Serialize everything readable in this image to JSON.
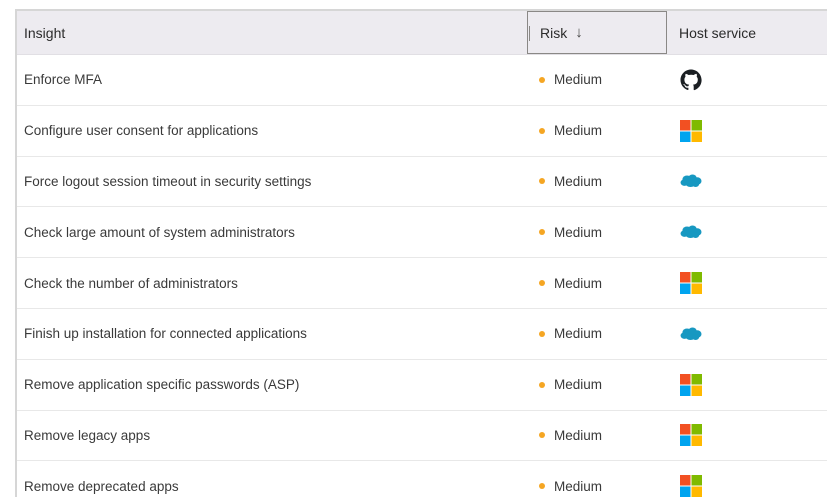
{
  "header": {
    "insight": "Insight",
    "risk": "Risk",
    "risk_sort_icon": "arrow-down-icon",
    "host_service": "Host service"
  },
  "colors": {
    "header_bg": "#edebf0",
    "risk_dot": "#f5a623",
    "salesforce": "#1798c1",
    "github": "#1b1f23",
    "microsoft_red": "#f25022",
    "microsoft_green": "#7fba00",
    "microsoft_blue": "#00a4ef",
    "microsoft_yellow": "#ffb900"
  },
  "rows": [
    {
      "insight": "Enforce MFA",
      "risk": "Medium",
      "service_icon": "github-icon"
    },
    {
      "insight": "Configure user consent for applications",
      "risk": "Medium",
      "service_icon": "microsoft-icon"
    },
    {
      "insight": "Force logout session timeout in security settings",
      "risk": "Medium",
      "service_icon": "salesforce-icon"
    },
    {
      "insight": "Check large amount of system administrators",
      "risk": "Medium",
      "service_icon": "salesforce-icon"
    },
    {
      "insight": "Check the number of administrators",
      "risk": "Medium",
      "service_icon": "microsoft-icon"
    },
    {
      "insight": "Finish up installation for connected applications",
      "risk": "Medium",
      "service_icon": "salesforce-icon"
    },
    {
      "insight": "Remove application specific passwords (ASP)",
      "risk": "Medium",
      "service_icon": "microsoft-icon"
    },
    {
      "insight": "Remove legacy apps",
      "risk": "Medium",
      "service_icon": "microsoft-icon"
    },
    {
      "insight": "Remove deprecated apps",
      "risk": "Medium",
      "service_icon": "microsoft-icon"
    }
  ]
}
